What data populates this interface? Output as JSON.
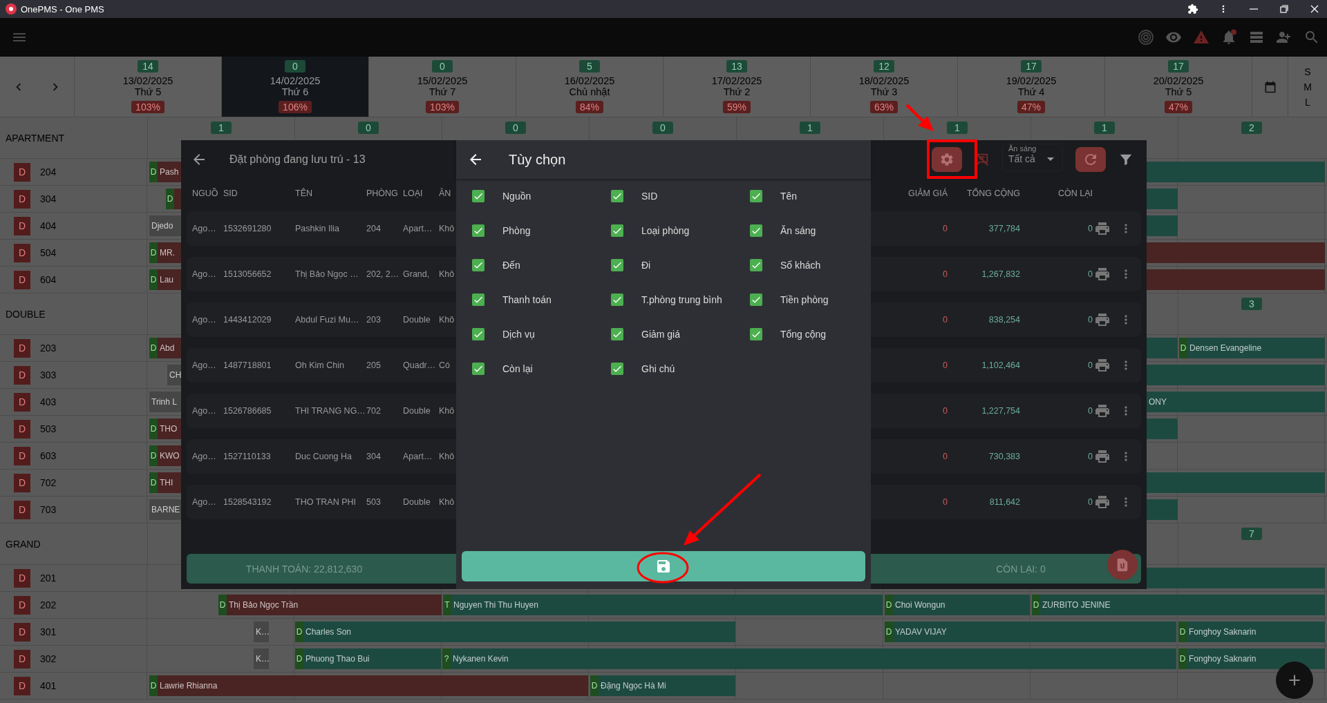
{
  "window": {
    "title": "OnePMS - One PMS"
  },
  "dates": [
    {
      "count": "14",
      "date": "13/02/2025",
      "weekday": "Thứ 5",
      "occupancy": "103%",
      "selected": false
    },
    {
      "count": "0",
      "date": "14/02/2025",
      "weekday": "Thứ 6",
      "occupancy": "106%",
      "selected": true
    },
    {
      "count": "0",
      "date": "15/02/2025",
      "weekday": "Thứ 7",
      "occupancy": "103%",
      "selected": false
    },
    {
      "count": "5",
      "date": "16/02/2025",
      "weekday": "Chủ nhật",
      "occupancy": "84%",
      "selected": false
    },
    {
      "count": "13",
      "date": "17/02/2025",
      "weekday": "Thứ 2",
      "occupancy": "59%",
      "selected": false
    },
    {
      "count": "12",
      "date": "18/02/2025",
      "weekday": "Thứ 3",
      "occupancy": "63%",
      "selected": false
    },
    {
      "count": "17",
      "date": "19/02/2025",
      "weekday": "Thứ 4",
      "occupancy": "47%",
      "selected": false
    },
    {
      "count": "17",
      "date": "20/02/2025",
      "weekday": "Thứ 5",
      "occupancy": "47%",
      "selected": false
    }
  ],
  "size_options": [
    "S",
    "M",
    "L"
  ],
  "room_groups": [
    {
      "name": "APARTMENT",
      "counts": [
        "1",
        "0",
        "0",
        "0",
        "1",
        "1",
        "1",
        "2"
      ],
      "rooms": [
        {
          "status": "D",
          "number": "204",
          "bookings": [
            {
              "flag": "D",
              "name": "Pash",
              "color": "#4a2323"
            },
            {
              "color": "#1d4a40"
            }
          ]
        },
        {
          "status": "D",
          "number": "304",
          "bookings": [
            {
              "flag": "D",
              "color": "#4a2323"
            },
            {
              "color": "#1d4a40"
            }
          ]
        },
        {
          "status": "D",
          "number": "404",
          "bookings": [
            {
              "name": "Djedo",
              "color": "#464646"
            },
            {
              "color": "#1d4a40"
            }
          ]
        },
        {
          "status": "D",
          "number": "504",
          "bookings": [
            {
              "flag": "D",
              "name": "MR.",
              "color": "#4a2323"
            },
            {
              "color": "#4a2323"
            }
          ]
        },
        {
          "status": "D",
          "number": "604",
          "bookings": [
            {
              "flag": "D",
              "name": "Lau",
              "color": "#4a2323"
            },
            {
              "color": "#4a2323"
            }
          ]
        }
      ]
    },
    {
      "name": "DOUBLE",
      "counts": [
        "3"
      ],
      "rooms": [
        {
          "status": "D",
          "number": "203",
          "bookings": [
            {
              "flag": "D",
              "name": "Abd",
              "color": "#4a2323"
            },
            {
              "color": "#1d4a40"
            },
            {
              "flag": "D",
              "name": "Densen Evangeline",
              "color": "#1d4a40"
            }
          ]
        },
        {
          "status": "D",
          "number": "303",
          "bookings": [
            {
              "name": "CH",
              "color": "#464646"
            },
            {
              "color": "#1d4a40"
            }
          ]
        },
        {
          "status": "D",
          "number": "403",
          "bookings": [
            {
              "name": "Trinh L",
              "color": "#464646"
            },
            {
              "name": "ONY",
              "color": "#1d4a40"
            }
          ]
        },
        {
          "status": "D",
          "number": "503",
          "bookings": [
            {
              "flag": "D",
              "name": "THO",
              "color": "#4a2323"
            },
            {
              "color": "#1d4a40"
            }
          ]
        },
        {
          "status": "D",
          "number": "603",
          "bookings": [
            {
              "flag": "D",
              "name": "KWO",
              "color": "#4a2323"
            }
          ]
        },
        {
          "status": "D",
          "number": "702",
          "bookings": [
            {
              "flag": "D",
              "name": "THI",
              "color": "#4a2323"
            },
            {
              "color": "#1d4a40"
            }
          ]
        },
        {
          "status": "D",
          "number": "703",
          "bookings": [
            {
              "name": "BARNE",
              "color": "#464646"
            },
            {
              "color": "#1d4a40"
            }
          ]
        }
      ]
    },
    {
      "name": "GRAND",
      "counts": [
        "7"
      ],
      "rooms": [
        {
          "status": "D",
          "number": "201",
          "bookings": [
            {
              "color": "#1d4a40"
            }
          ]
        },
        {
          "status": "D",
          "number": "202",
          "bookings": [
            {
              "flag": "D",
              "name": "Thị Bảo Ngọc Trần",
              "color": "#4a2323"
            },
            {
              "flag": "T",
              "name": "Nguyen Thi Thu Huyen",
              "color": "#1d4a40"
            },
            {
              "flag": "D",
              "name": "Choi Wongun",
              "color": "#1d4a40"
            },
            {
              "flag": "D",
              "name": "ZURBITO JENINE",
              "color": "#1d4a40"
            }
          ]
        },
        {
          "status": "D",
          "number": "301",
          "bookings": [
            {
              "name": "K…",
              "color": "#464646"
            },
            {
              "flag": "D",
              "name": "Charles Son",
              "color": "#1d4a40"
            },
            {
              "flag": "D",
              "name": "YADAV VIJAY",
              "color": "#1d4a40"
            },
            {
              "flag": "D",
              "name": "Fonghoy Saknarin",
              "color": "#1d4a40"
            }
          ]
        },
        {
          "status": "D",
          "number": "302",
          "bookings": [
            {
              "name": "K…",
              "color": "#464646"
            },
            {
              "flag": "D",
              "name": "Phuong Thao Bui",
              "color": "#1d4a40"
            },
            {
              "flag": "?",
              "name": "Nykanen Kevin",
              "color": "#1d4a40"
            },
            {
              "flag": "D",
              "name": "Fonghoy Saknarin",
              "color": "#1d4a40"
            }
          ]
        },
        {
          "status": "D",
          "number": "401",
          "bookings": [
            {
              "flag": "D",
              "name": "Lawrie Rhianna",
              "color": "#4a2323"
            },
            {
              "flag": "D",
              "name": "Đặng Ngọc Hà Mi",
              "color": "#1d4a40"
            }
          ]
        }
      ]
    }
  ],
  "booking_list": {
    "title": "Đặt phòng đang lưu trú - 13",
    "breakfast_filter": {
      "label": "Ăn sáng",
      "value": "Tất cả"
    },
    "columns_left": [
      "NGUỒ",
      "SID",
      "TÊN",
      "PHÒNG",
      "LOẠI",
      "ĂN"
    ],
    "columns_right": [
      "GIẢM GIÁ",
      "TỔNG CỘNG",
      "CÒN LẠI"
    ],
    "rows": [
      {
        "source": "Ago…",
        "sid": "1532691280",
        "name": "Pashkin Ilia",
        "room": "204",
        "type": "Apart…",
        "breakfast": "Khô",
        "discount": "0",
        "total": "377,784",
        "remaining": "0"
      },
      {
        "source": "Ago…",
        "sid": "1513056652",
        "name": "Thị Bảo Ngọc …",
        "room": "202, 2…",
        "type": "Grand,",
        "breakfast": "Khô",
        "discount": "0",
        "total": "1,267,832",
        "remaining": "0"
      },
      {
        "source": "Ago…",
        "sid": "1443412029",
        "name": "Abdul Fuzi Mu…",
        "room": "203",
        "type": "Double",
        "breakfast": "Khô",
        "discount": "0",
        "total": "838,254",
        "remaining": "0"
      },
      {
        "source": "Ago…",
        "sid": "1487718801",
        "name": "Oh Kim Chin",
        "room": "205",
        "type": "Quadr…",
        "breakfast": "Có",
        "discount": "0",
        "total": "1,102,464",
        "remaining": "0"
      },
      {
        "source": "Ago…",
        "sid": "1526786685",
        "name": "THI TRANG NG…",
        "room": "702",
        "type": "Double",
        "breakfast": "Khô",
        "discount": "0",
        "total": "1,227,754",
        "remaining": "0"
      },
      {
        "source": "Ago…",
        "sid": "1527110133",
        "name": "Duc Cuong Ha",
        "room": "304",
        "type": "Apart…",
        "breakfast": "Khô",
        "discount": "0",
        "total": "730,383",
        "remaining": "0"
      },
      {
        "source": "Ago…",
        "sid": "1528543192",
        "name": "THO TRAN PHI",
        "room": "503",
        "type": "Double",
        "breakfast": "Khô",
        "discount": "0",
        "total": "811,642",
        "remaining": "0"
      }
    ],
    "payment_total": "THANH TOÁN: 22,812,630",
    "remaining_total": "CÒN LẠI: 0"
  },
  "options_dialog": {
    "title": "Tùy chọn",
    "options": [
      {
        "label": "Nguồn",
        "checked": true
      },
      {
        "label": "SID",
        "checked": true
      },
      {
        "label": "Tên",
        "checked": true
      },
      {
        "label": "Phòng",
        "checked": true
      },
      {
        "label": "Loại phòng",
        "checked": true
      },
      {
        "label": "Ăn sáng",
        "checked": true
      },
      {
        "label": "Đến",
        "checked": true
      },
      {
        "label": "Đi",
        "checked": true
      },
      {
        "label": "Số khách",
        "checked": true
      },
      {
        "label": "Thanh toán",
        "checked": true
      },
      {
        "label": "T.phòng trung bình",
        "checked": true
      },
      {
        "label": "Tiền phòng",
        "checked": true
      },
      {
        "label": "Dịch vụ",
        "checked": true
      },
      {
        "label": "Giảm giá",
        "checked": true
      },
      {
        "label": "Tổng cộng",
        "checked": true
      },
      {
        "label": "Còn lại",
        "checked": true
      },
      {
        "label": "Ghi chú",
        "checked": true
      }
    ]
  }
}
